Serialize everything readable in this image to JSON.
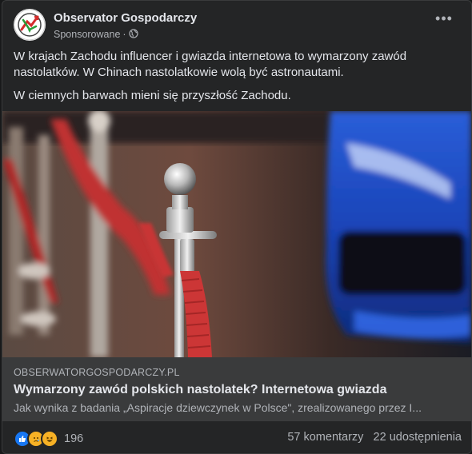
{
  "post": {
    "page_name": "Observator Gospodarczy",
    "sponsored_label": "Sponsorowane",
    "separator": "·",
    "more_label": "•••",
    "text_lines": [
      "W krajach Zachodu influencer i gwiazda internetowa to wymarzony zawód nastolatków. W Chinach nastolatkowie wolą być astronautami.",
      "W ciemnych barwach mieni się przyszłość Zachodu."
    ]
  },
  "link": {
    "domain": "OBSERWATORGOSPODARCZY.PL",
    "title": "Wymarzony zawód polskich nastolatek? Internetowa gwiazda",
    "description": "Jak wynika z badania  „Aspiracje dziewczynek w Polsce\", zrealizowanego przez I..."
  },
  "footer": {
    "reaction_icons": [
      "like-icon",
      "sad-icon",
      "haha-icon"
    ],
    "reaction_count": "196",
    "comments": "57 komentarzy",
    "shares": "22 udostępnienia"
  },
  "colors": {
    "background": "#18191a",
    "card": "#242526",
    "link_box": "#3a3b3c",
    "primary_text": "#e4e6eb",
    "secondary_text": "#b0b3b8",
    "like_blue": "#1877f2",
    "reaction_yellow": "#f7b125"
  }
}
